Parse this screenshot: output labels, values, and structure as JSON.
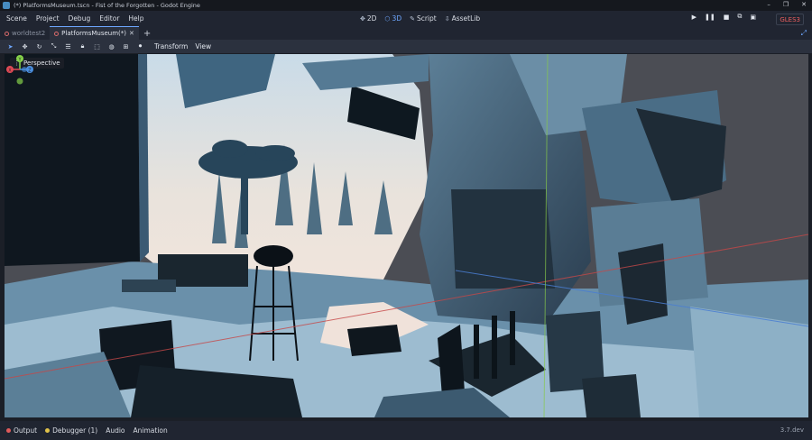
{
  "window": {
    "title": "(*) PlatformsMuseum.tscn - Fist of the Forgotten - Godot Engine",
    "controls": [
      "–",
      "❐",
      "✕"
    ]
  },
  "menu": [
    "Scene",
    "Project",
    "Debug",
    "Editor",
    "Help"
  ],
  "workspaces": [
    {
      "label": "2D",
      "icon": "2d-icon",
      "active": false
    },
    {
      "label": "3D",
      "icon": "3d-icon",
      "active": true
    },
    {
      "label": "Script",
      "icon": "script-icon",
      "active": false
    },
    {
      "label": "AssetLib",
      "icon": "assetlib-icon",
      "active": false
    }
  ],
  "playback": [
    "play-icon",
    "pause-icon",
    "stop-icon",
    "play-scene-icon",
    "play-custom-icon"
  ],
  "renderer": "GLES3",
  "tabs": [
    {
      "label": "worldtest2",
      "active": false
    },
    {
      "label": "PlatformsMuseum(*)",
      "active": true
    }
  ],
  "toolbar": {
    "tools": [
      "select-icon",
      "move-icon",
      "rotate-icon",
      "scale-icon",
      "list-icon",
      "lock-icon",
      "group-icon",
      "local-space-icon",
      "snap-icon",
      "camera-icon"
    ],
    "menus": [
      "Transform",
      "View"
    ]
  },
  "viewport": {
    "mode_label": "Perspective",
    "gizmo_axes": [
      "X",
      "Y",
      "Z"
    ],
    "axis_colors": {
      "x": "#e04a55",
      "y": "#86d34a",
      "z": "#4a8fe0"
    }
  },
  "bottom_panels": [
    {
      "label": "Output",
      "dot_color": "#e05a5a"
    },
    {
      "label": "Debugger (1)",
      "dot_color": "#e0c24a"
    },
    {
      "label": "Audio",
      "dot_color": ""
    },
    {
      "label": "Animation",
      "dot_color": ""
    }
  ],
  "version": "3.7.dev"
}
